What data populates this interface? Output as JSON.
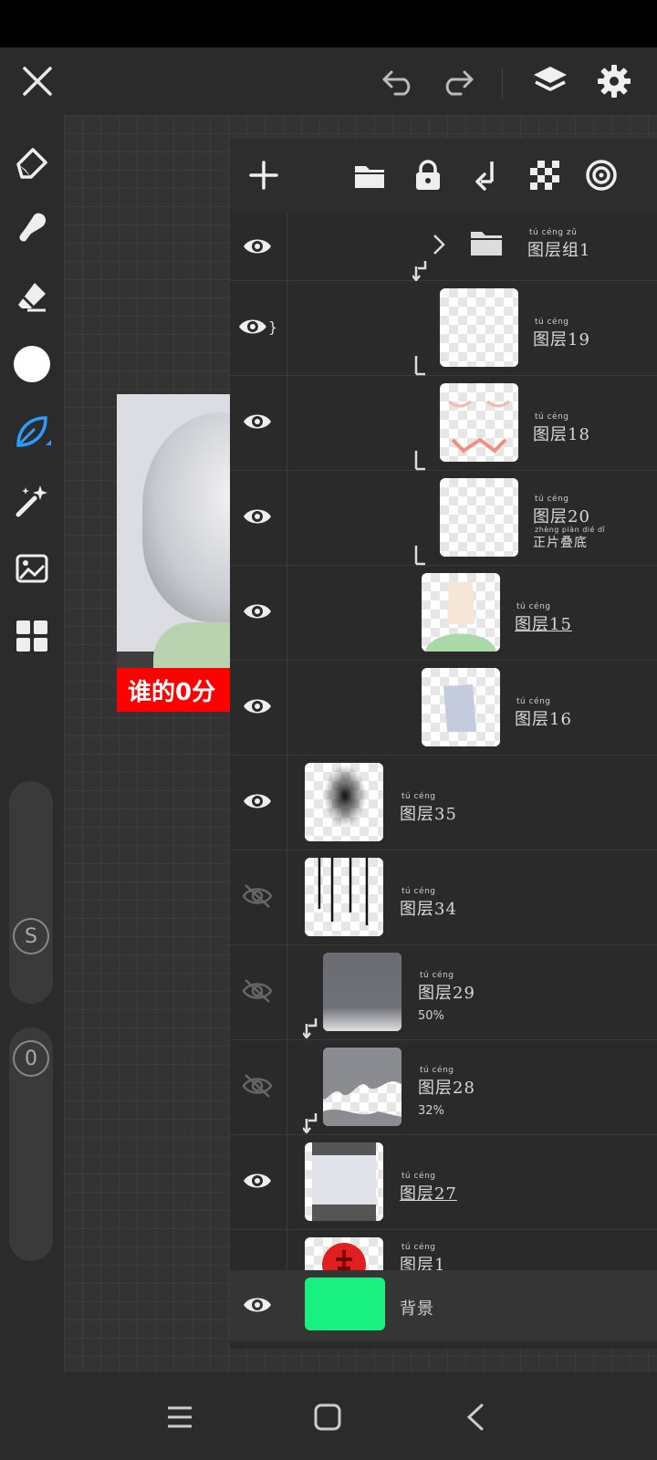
{
  "topbar": {
    "close": "close-icon",
    "undo": "undo-icon",
    "redo": "redo-icon",
    "layers": "layers-icon",
    "settings": "gear-icon"
  },
  "tools": [
    "pen-icon",
    "smudge-icon",
    "eraser-icon",
    "color-swatch",
    "brush-leaf-icon",
    "magic-wand-icon",
    "image-import-icon",
    "gallery-grid-icon"
  ],
  "sliders": {
    "size_label": "S",
    "opacity_label": "0"
  },
  "artwork": {
    "caption": "谁的0分"
  },
  "colors": {
    "accent": "#2e9bff",
    "background_layer": "#18f080",
    "caption_bg": "#ff0000"
  },
  "layers_toolbar": [
    "add-layer-icon",
    "folder-icon",
    "lock-icon",
    "merge-down-icon",
    "transparency-icon",
    "target-icon"
  ],
  "layers": [
    {
      "name": "图层组1",
      "ruby": "tú céng zǔ",
      "type": "group",
      "visible": true
    },
    {
      "name": "图层19",
      "ruby": "tú céng",
      "visible": true,
      "clipped": true
    },
    {
      "name": "图层18",
      "ruby": "tú céng",
      "visible": true,
      "clipped": true
    },
    {
      "name": "图层20",
      "ruby": "tú céng",
      "sub": "正片叠底",
      "sub_ruby": "zhèng piàn dié dǐ",
      "visible": true,
      "clipped": true
    },
    {
      "name": "图层15",
      "ruby": "tú céng",
      "visible": true,
      "selected": true
    },
    {
      "name": "图层16",
      "ruby": "tú céng",
      "visible": true
    },
    {
      "name": "图层35",
      "ruby": "tú céng",
      "visible": true
    },
    {
      "name": "图层34",
      "ruby": "tú céng",
      "visible": false
    },
    {
      "name": "图层29",
      "ruby": "tú céng",
      "opacity": "50%",
      "visible": false,
      "clipped": true
    },
    {
      "name": "图层28",
      "ruby": "tú céng",
      "opacity": "32%",
      "visible": false,
      "clipped": true
    },
    {
      "name": "图层27",
      "ruby": "tú céng",
      "visible": true,
      "selected": true
    },
    {
      "name": "图层1",
      "ruby": "tú céng",
      "visible": true
    },
    {
      "name": "背景",
      "visible": true,
      "background": true
    }
  ],
  "nav": [
    "recent-apps-icon",
    "home-icon",
    "back-icon"
  ]
}
